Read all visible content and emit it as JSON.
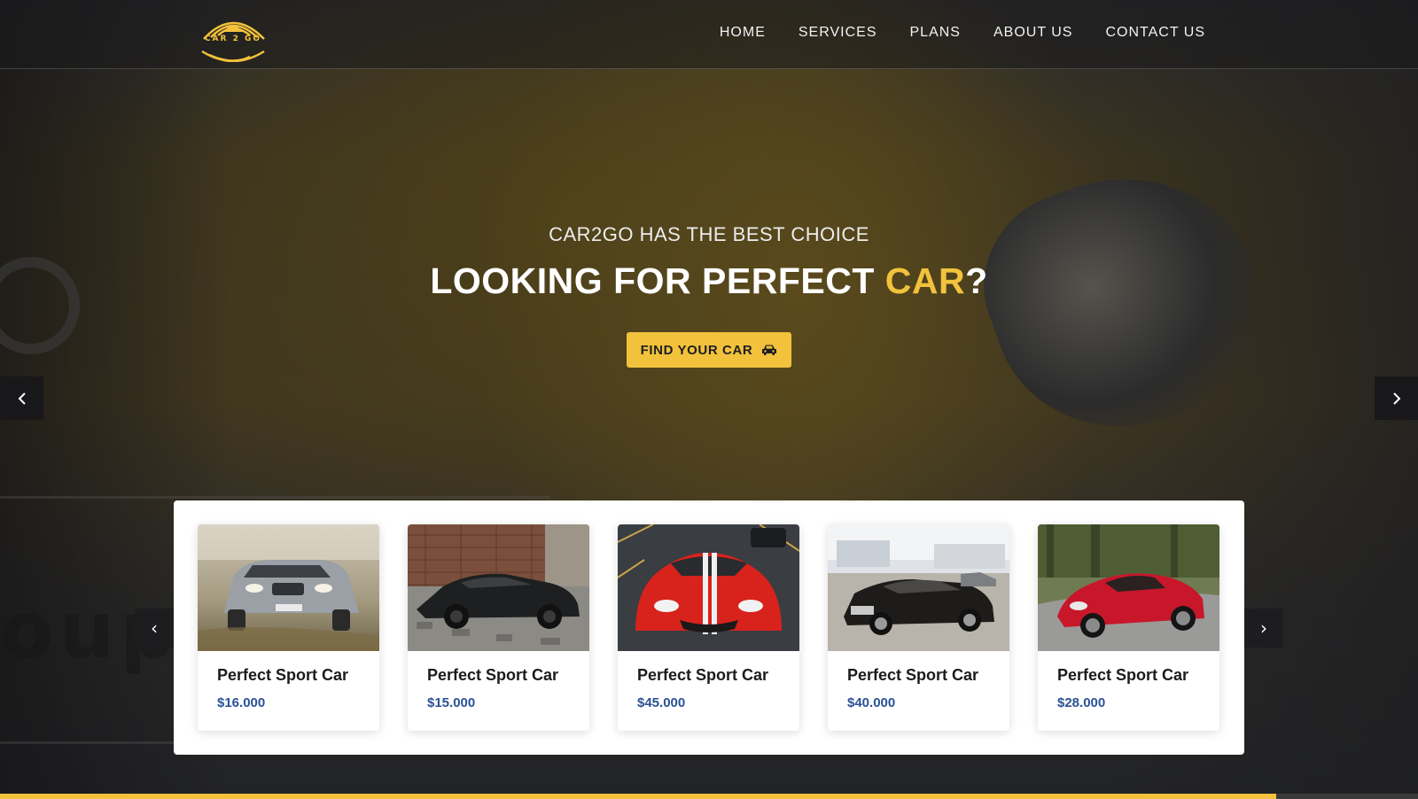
{
  "brand": {
    "logo_text": "CAR 2 GO",
    "accent_color": "#f2c23c"
  },
  "nav": {
    "items": [
      {
        "label": "HOME"
      },
      {
        "label": "SERVICES"
      },
      {
        "label": "PLANS"
      },
      {
        "label": "ABOUT US"
      },
      {
        "label": "CONTACT US"
      }
    ]
  },
  "hero": {
    "subtitle": "CAR2GO HAS THE BEST CHOICE",
    "title_main": "LOOKING FOR PERFECT ",
    "title_accent": "CAR",
    "title_end": "?",
    "cta_label": "FIND YOUR CAR",
    "cta_icon": "car-icon",
    "prev_icon": "chevron-left-icon",
    "next_icon": "chevron-right-icon"
  },
  "carousel": {
    "prev_label": "‹",
    "next_label": "›",
    "cards": [
      {
        "name": "Perfect Sport Car",
        "price": "$16.000",
        "photo": "silver-suv"
      },
      {
        "name": "Perfect Sport Car",
        "price": "$15.000",
        "photo": "black-sedan"
      },
      {
        "name": "Perfect Sport Car",
        "price": "$45.000",
        "photo": "red-viper"
      },
      {
        "name": "Perfect Sport Car",
        "price": "$40.000",
        "photo": "black-muscle-car"
      },
      {
        "name": "Perfect Sport Car",
        "price": "$28.000",
        "photo": "red-alfa"
      }
    ]
  },
  "slider_progress": 0.9,
  "background_text": "oup"
}
